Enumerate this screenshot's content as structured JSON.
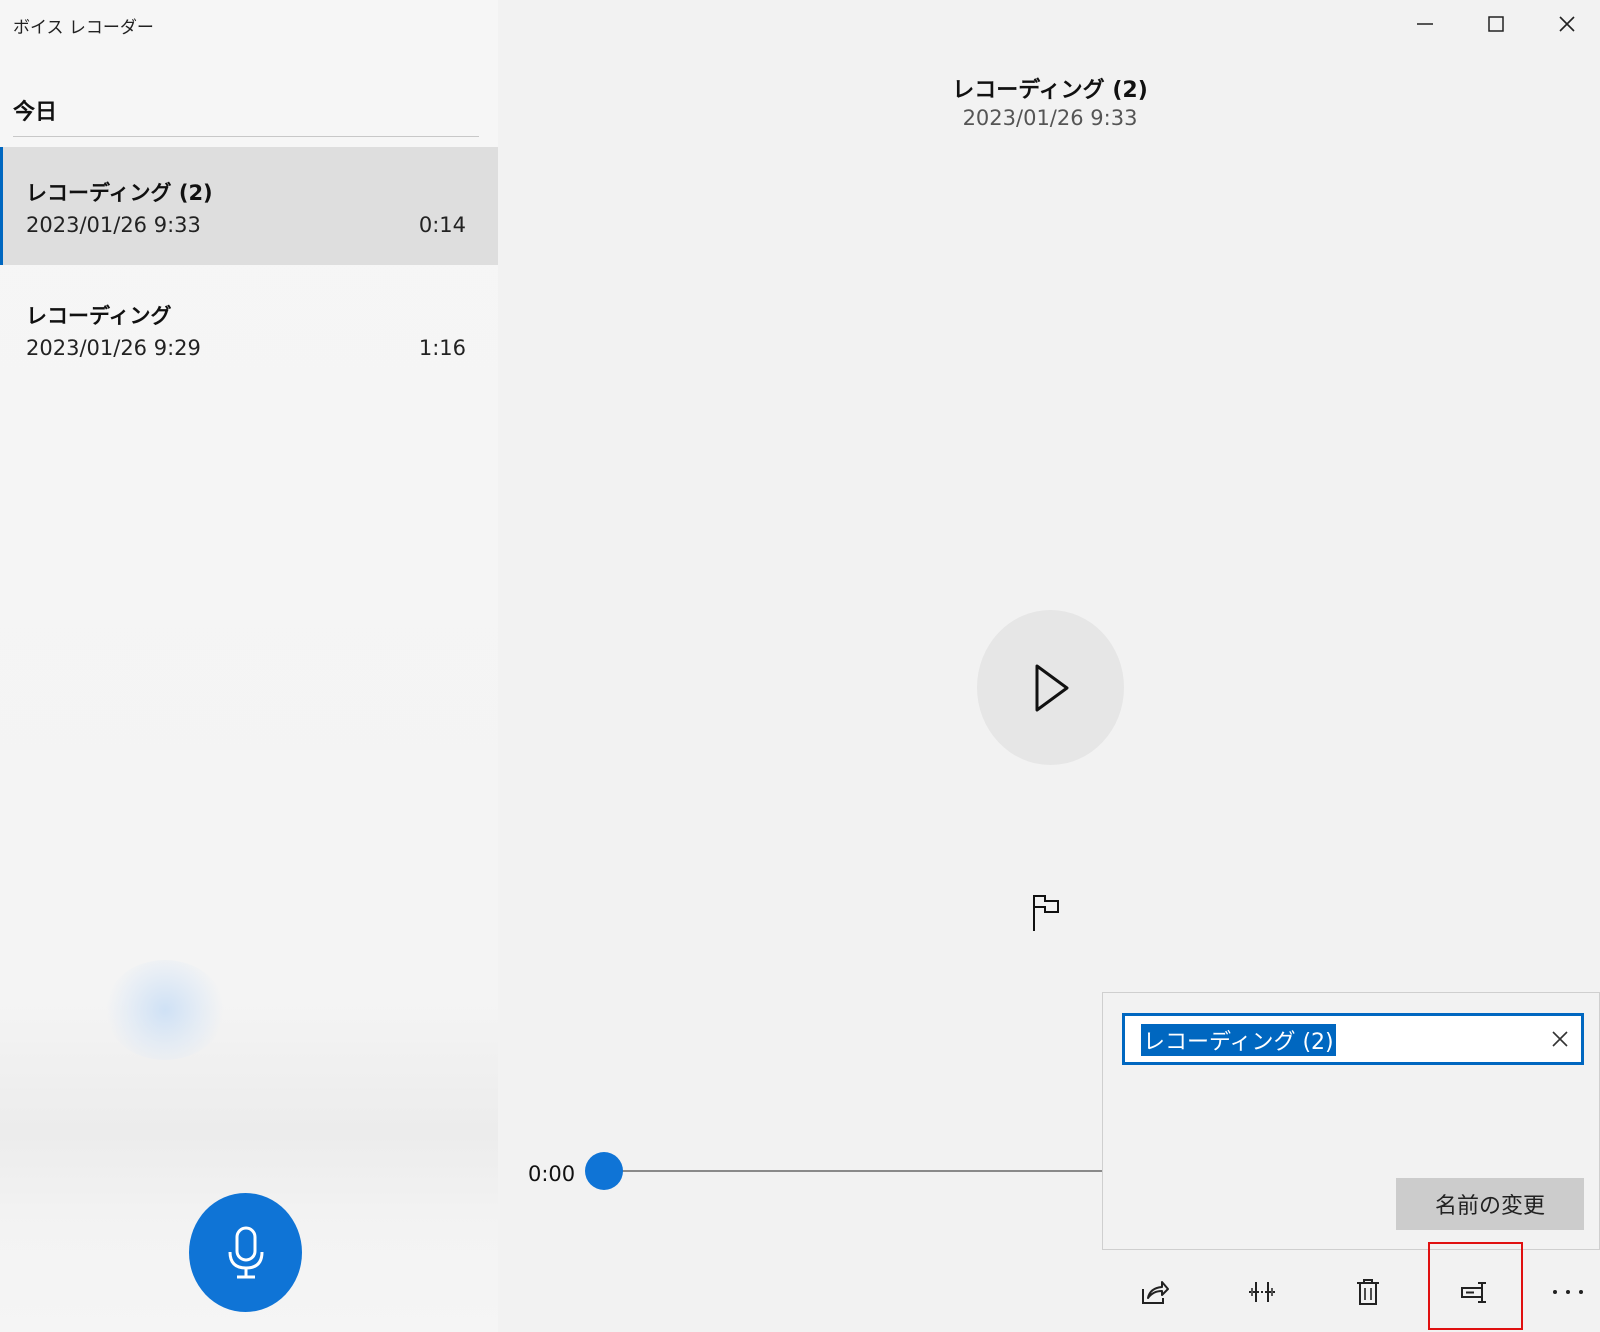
{
  "app": {
    "title": "ボイス レコーダー"
  },
  "sidebar": {
    "section_header": "今日",
    "recordings": [
      {
        "name": "レコーディング (2)",
        "date": "2023/01/26 9:33",
        "duration": "0:14",
        "selected": true
      },
      {
        "name": "レコーディング",
        "date": "2023/01/26 9:29",
        "duration": "1:16",
        "selected": false
      }
    ]
  },
  "main": {
    "title": "レコーディング (2)",
    "date": "2023/01/26 9:33",
    "current_time": "0:00",
    "playback_progress": 0
  },
  "rename": {
    "value": "レコーディング (2)",
    "button_label": "名前の変更"
  },
  "icons": {
    "window": [
      "minimize-icon",
      "maximize-icon",
      "close-icon"
    ],
    "toolbar": [
      "share-icon",
      "trim-icon",
      "delete-icon",
      "rename-icon",
      "more-icon"
    ],
    "record": "microphone-icon",
    "play": "play-icon",
    "marker": "flag-icon"
  },
  "colors": {
    "accent": "#0067c0",
    "highlight": "#e01010",
    "selected_bg": "#dedede"
  }
}
